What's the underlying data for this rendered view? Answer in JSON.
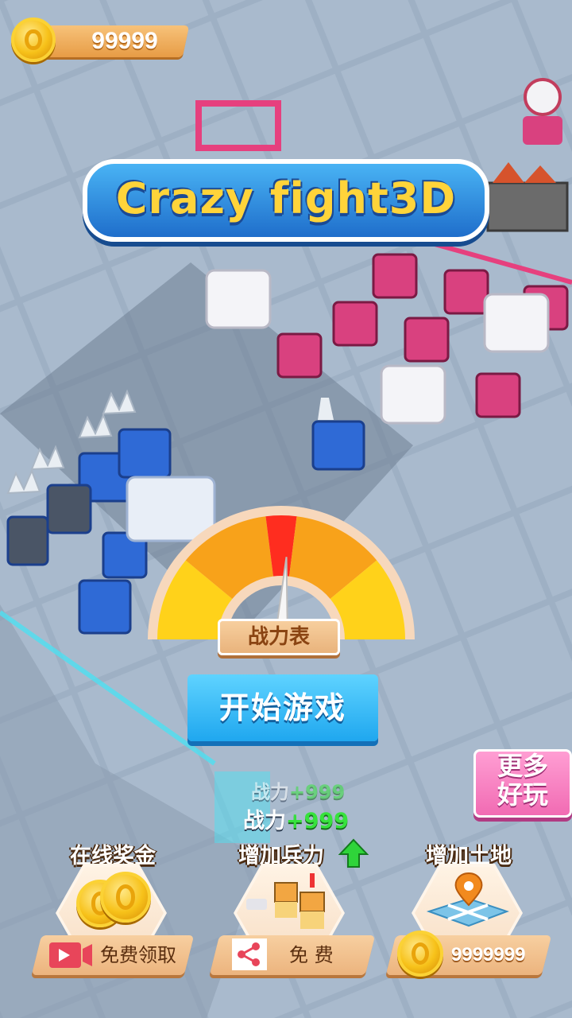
{
  "coins": {
    "amount": "99999"
  },
  "title": "Crazy fight3D",
  "gauge": {
    "label": "战力表",
    "level": 0.52
  },
  "start_button": "开始游戏",
  "more_games": {
    "line1": "更多",
    "line2": "好玩"
  },
  "power_bonus": [
    {
      "label": "战力",
      "value": "+999"
    },
    {
      "label": "战力",
      "value": "+999"
    }
  ],
  "cards": [
    {
      "title": "在线奖金",
      "button": "免费领取",
      "icon": "gold-coins-icon",
      "button_icon": "video-icon"
    },
    {
      "title": "增加兵力",
      "button": "免 费",
      "icon": "soldiers-icon",
      "button_icon": "share-icon",
      "badge_icon": "green-up-arrow-icon"
    },
    {
      "title": "增加土地",
      "button": "9999999",
      "icon": "map-pin-icon",
      "button_icon": "coin-icon"
    }
  ],
  "colors": {
    "accent_blue": "#1fa7ef",
    "pink": "#f16bb3",
    "gold": "#f7c21a",
    "orange_bar": "#ecb47e"
  }
}
